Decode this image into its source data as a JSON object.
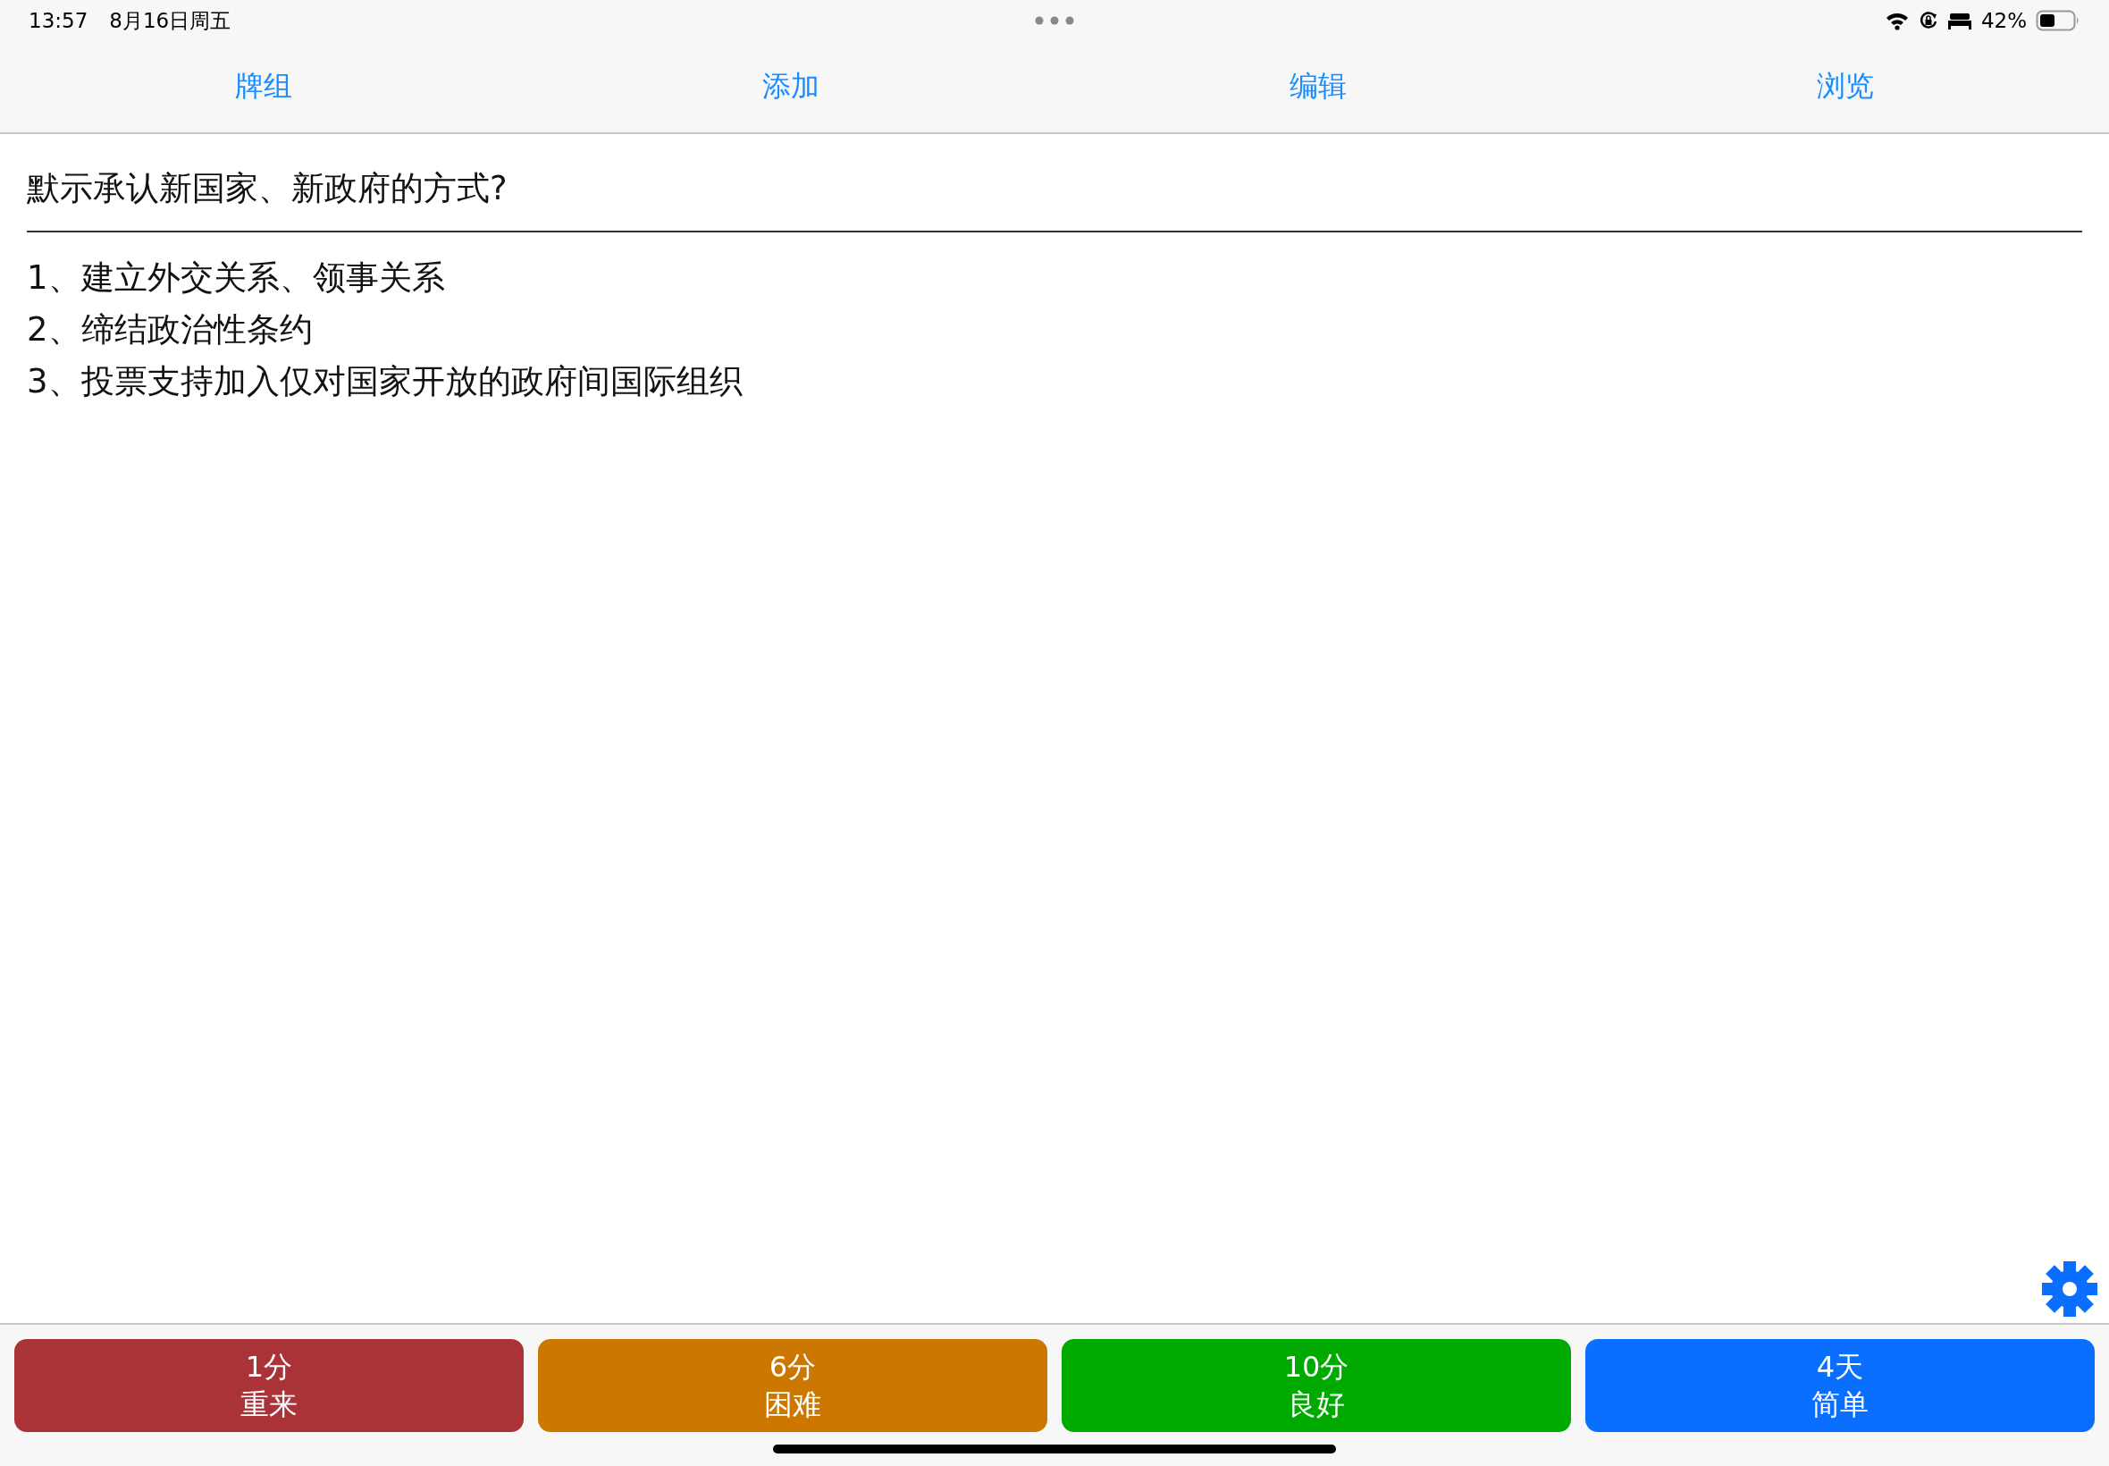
{
  "status_bar": {
    "time": "13:57",
    "date": "8月16日周五",
    "battery": "42%"
  },
  "tabs": [
    {
      "label": "牌组"
    },
    {
      "label": "添加"
    },
    {
      "label": "编辑"
    },
    {
      "label": "浏览"
    }
  ],
  "card": {
    "question": "默示承认新国家、新政府的方式?",
    "answer_lines": [
      "1、建立外交关系、领事关系",
      "2、缔结政治性条约",
      "3、投票支持加入仅对国家开放的政府间国际组织"
    ]
  },
  "answer_buttons": [
    {
      "interval": "1分",
      "label": "重来",
      "color": "#a93336"
    },
    {
      "interval": "6分",
      "label": "困难",
      "color": "#cc7700"
    },
    {
      "interval": "10分",
      "label": "良好",
      "color": "#00aa00"
    },
    {
      "interval": "4天",
      "label": "简单",
      "color": "#0a6fff"
    }
  ]
}
